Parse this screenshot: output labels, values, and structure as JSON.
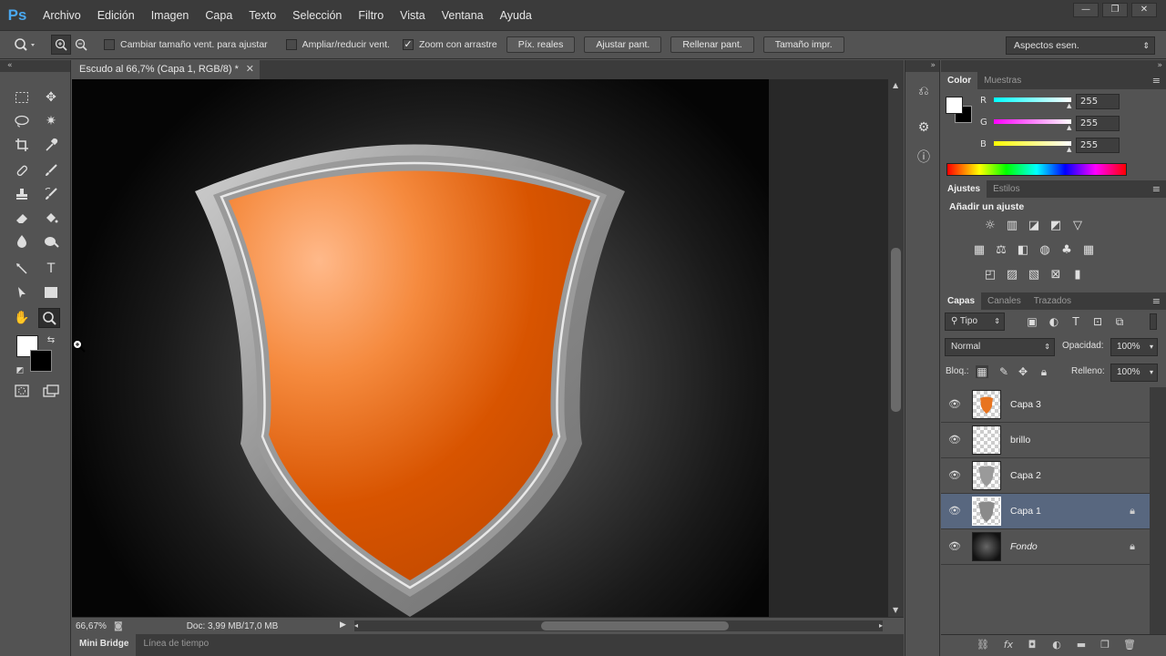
{
  "app": {
    "logo": "Ps"
  },
  "menu": [
    "Archivo",
    "Edición",
    "Imagen",
    "Capa",
    "Texto",
    "Selección",
    "Filtro",
    "Vista",
    "Ventana",
    "Ayuda"
  ],
  "window_controls": {
    "minimize": "—",
    "restore": "❐",
    "close": "✕"
  },
  "options": {
    "tool_icon": "zoom-icon",
    "chk_resize": "Cambiar tamaño vent. para ajustar",
    "chk_resize_checked": false,
    "chk_zoom_all": "Ampliar/reducir vent.",
    "chk_zoom_all_checked": false,
    "chk_scrubby": "Zoom con arrastre",
    "chk_scrubby_checked": true,
    "btn_actual": "Píx. reales",
    "btn_fit": "Ajustar pant.",
    "btn_fill": "Rellenar pant.",
    "btn_print": "Tamaño impr.",
    "workspace": "Aspectos esen."
  },
  "document": {
    "tab_title": "Escudo al 66,7% (Capa 1, RGB/8) *",
    "zoom": "66,67%",
    "doc_info": "Doc: 3,99 MB/17,0 MB"
  },
  "bottom_tabs": [
    "Mini Bridge",
    "Línea de tiempo"
  ],
  "color_panel": {
    "tabs": [
      "Color",
      "Muestras"
    ],
    "channels": [
      {
        "label": "R",
        "value": "255",
        "color": "#00ffff"
      },
      {
        "label": "G",
        "value": "255",
        "color": "#ff00ff"
      },
      {
        "label": "B",
        "value": "255",
        "color": "#ffff00"
      }
    ],
    "foreground": "#ffffff",
    "background": "#000000"
  },
  "adjustments_panel": {
    "tabs": [
      "Ajustes",
      "Estilos"
    ],
    "title": "Añadir un ajuste"
  },
  "layers_panel": {
    "tabs": [
      "Capas",
      "Canales",
      "Trazados"
    ],
    "filter": "Tipo",
    "blend_mode": "Normal",
    "opacity_label": "Opacidad:",
    "opacity": "100%",
    "lock_label": "Bloq.:",
    "fill_label": "Relleno:",
    "fill": "100%",
    "layers": [
      {
        "name": "Capa 3",
        "selected": false,
        "locked": false
      },
      {
        "name": "brillo",
        "selected": false,
        "locked": false
      },
      {
        "name": "Capa 2",
        "selected": false,
        "locked": false
      },
      {
        "name": "Capa 1",
        "selected": true,
        "locked": true
      },
      {
        "name": "Fondo",
        "selected": false,
        "locked": true
      }
    ]
  },
  "shield": {
    "orange_light": "#ffb98a",
    "orange_dark": "#d85400",
    "rim_outer": "#8a8a8a",
    "rim_light": "#d8d8d8"
  }
}
